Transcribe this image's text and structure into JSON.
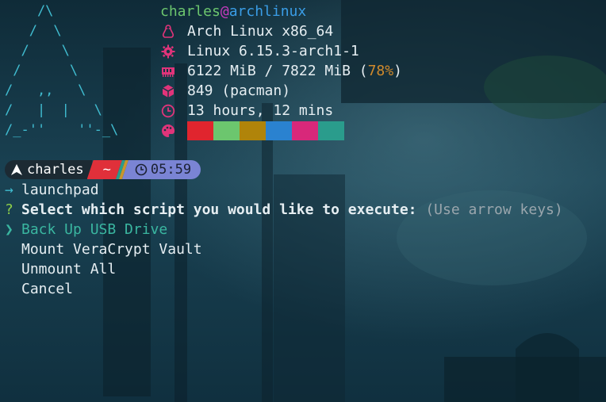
{
  "colors": {
    "ascii": "#40bcd0",
    "user": "#6cc66e",
    "at": "#c83ac0",
    "host": "#3a9de6",
    "percent": "#d08a2c",
    "icon": "#e0347a",
    "question": "#8fd04a",
    "hint": "#9aa6ad",
    "selected": "#3ab6a0"
  },
  "ascii_art": "    /\\\n   /  \\\n  /    \\\n /      \\\n/   ,,   \\\n/   |  |   \\\n/_-''    ''-_\\",
  "fetch": {
    "user": "charles",
    "at": "@",
    "host": "archlinux",
    "os": {
      "icon": "linux-icon",
      "text": "Arch Linux x86_64"
    },
    "kernel": {
      "icon": "gear-icon",
      "text": "Linux 6.15.3-arch1-1"
    },
    "memory": {
      "icon": "memory-icon",
      "prefix": "6122 MiB / 7822 MiB (",
      "percent": "78%",
      "suffix": ")"
    },
    "packages": {
      "icon": "package-icon",
      "text": "849 (pacman)"
    },
    "uptime": {
      "icon": "clock-icon",
      "text": "13 hours, 12 mins"
    },
    "palette": {
      "icon": "palette-icon",
      "swatches": [
        "#e0252e",
        "#6cc66e",
        "#b0840a",
        "#2a82d0",
        "#d8287a",
        "#2a9c8c"
      ]
    }
  },
  "prompt": {
    "user": "charles",
    "dir": "~",
    "time": "05:59",
    "stripes": [
      "#2a9c8c",
      "#c8962c"
    ]
  },
  "command": {
    "arrow": "→",
    "text": "launchpad"
  },
  "question": {
    "mark": "?",
    "text": "Select which script you would like to execute:",
    "hint": "(Use arrow keys)"
  },
  "menu": {
    "pointer": "❯",
    "selected_index": 0,
    "options": [
      "Back Up USB Drive",
      "Mount VeraCrypt Vault",
      "Unmount All",
      "Cancel"
    ]
  }
}
